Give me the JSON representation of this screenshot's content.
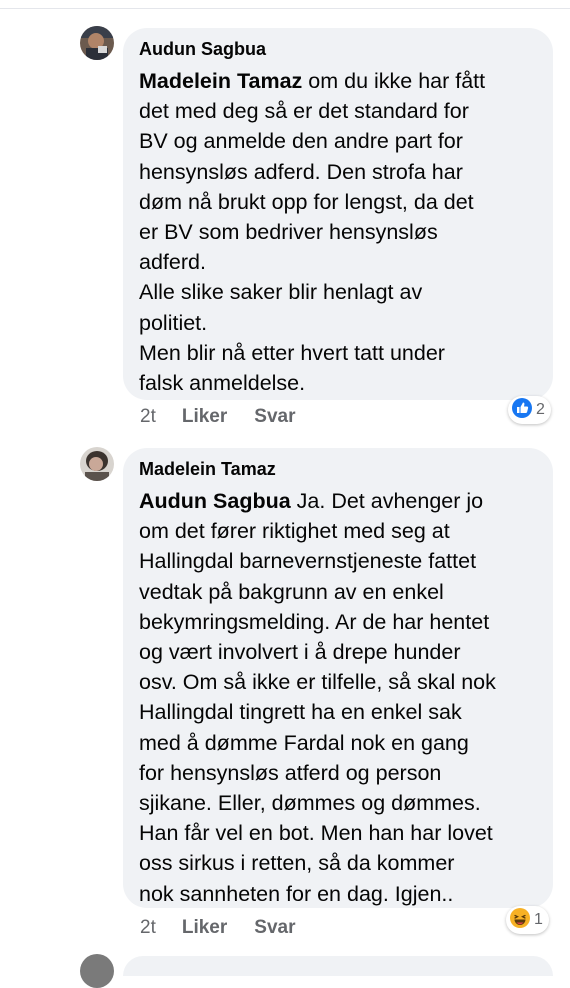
{
  "comments": [
    {
      "author": "Audun Sagbua",
      "mention": "Madelein Tamaz",
      "lines": [
        " om du ikke har fått",
        "det med deg så er det standard for",
        "BV og anmelde den andre part for",
        "hensynsløs adferd. Den strofa har",
        "døm nå brukt opp for lengst, da det",
        "er BV som bedriver hensynsløs",
        "adferd.",
        "Alle slike saker blir henlagt av",
        "politiet.",
        "Men blir nå etter hvert tatt under",
        "falsk anmeldelse."
      ],
      "time": "2t",
      "like_label": "Liker",
      "reply_label": "Svar",
      "reaction": {
        "icon": "like-reaction-icon",
        "count": "2",
        "color": "#1877f2"
      }
    },
    {
      "author": "Madelein Tamaz",
      "mention": "Audun Sagbua",
      "lines": [
        " Ja. Det avhenger jo",
        "om det fører riktighet med seg at",
        "Hallingdal barnevernstjeneste fattet",
        "vedtak på bakgrunn av en enkel",
        "bekymringsmelding. Ar de har hentet",
        "og vært involvert i å drepe hunder",
        "osv. Om så ikke er tilfelle, så skal nok",
        "Hallingdal tingrett ha en enkel sak",
        "med å dømme Fardal nok en gang",
        "for hensynsløs atferd og person",
        "sjikane. Eller, dømmes og dømmes.",
        "Han får vel en bot. Men han har lovet",
        "oss sirkus i retten, så da kommer",
        "nok sannheten for en dag. Igjen.."
      ],
      "time": "2t",
      "like_label": "Liker",
      "reply_label": "Svar",
      "reaction": {
        "icon": "haha-reaction-icon",
        "count": "1",
        "color": "#f7b125"
      }
    }
  ]
}
